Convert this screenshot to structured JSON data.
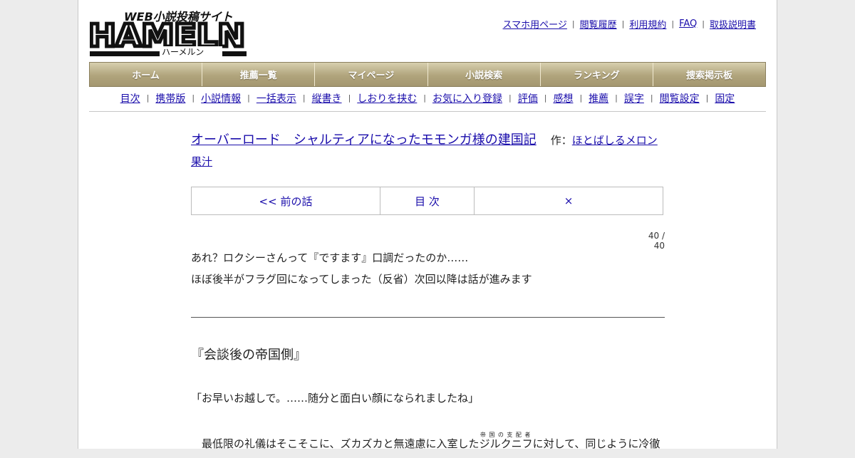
{
  "logo": {
    "text": "HAMELN",
    "subtitle": "WEB小説投稿サイト",
    "kana": "ハーメルン"
  },
  "top_links": [
    "スマホ用ページ",
    "閲覧履歴",
    "利用規約",
    "FAQ",
    "取扱説明書"
  ],
  "main_nav": [
    "ホーム",
    "推薦一覧",
    "マイページ",
    "小説検索",
    "ランキング",
    "捜索掲示板"
  ],
  "sub_nav": [
    "目次",
    "携帯版",
    "小説情報",
    "一括表示",
    "縦書き",
    "しおりを挟む",
    "お気に入り登録",
    "評価",
    "感想",
    "推薦",
    "誤字",
    "閲覧設定",
    "固定"
  ],
  "novel": {
    "title": "オーバーロード　シャルティアになったモモンガ様の建国記",
    "author_label": "作：",
    "author": "ほとばしるメロン果汁"
  },
  "chapter_nav": {
    "prev": "<< 前の話",
    "toc": "目 次",
    "close": "×"
  },
  "page_count": "40 / 40",
  "preface": {
    "line1": "あれ？ロクシーさんって『ですます』口調だったのか……",
    "line2": "ほぼ後半がフラグ回になってしまった（反省）次回以降は話が進みます"
  },
  "body": {
    "heading": "『会談後の帝国側』",
    "line1": "「お早いお越しで。……随分と面白い顔になられましたね」",
    "line2_before": "　最低限の礼儀はそこそこに、ズカズカと無遠慮に入室した",
    "line2_ruby_base": "ジルクニフ",
    "line2_ruby_text": "帝国の支配者",
    "line2_after": "に対して、同じように冷徹"
  },
  "colors": {
    "link": "#1a0dab",
    "nav_bar": "#b0a47c",
    "nav_text": "#ffffff",
    "page_bg": "#ffffff",
    "outer_bg": "#ececec"
  }
}
